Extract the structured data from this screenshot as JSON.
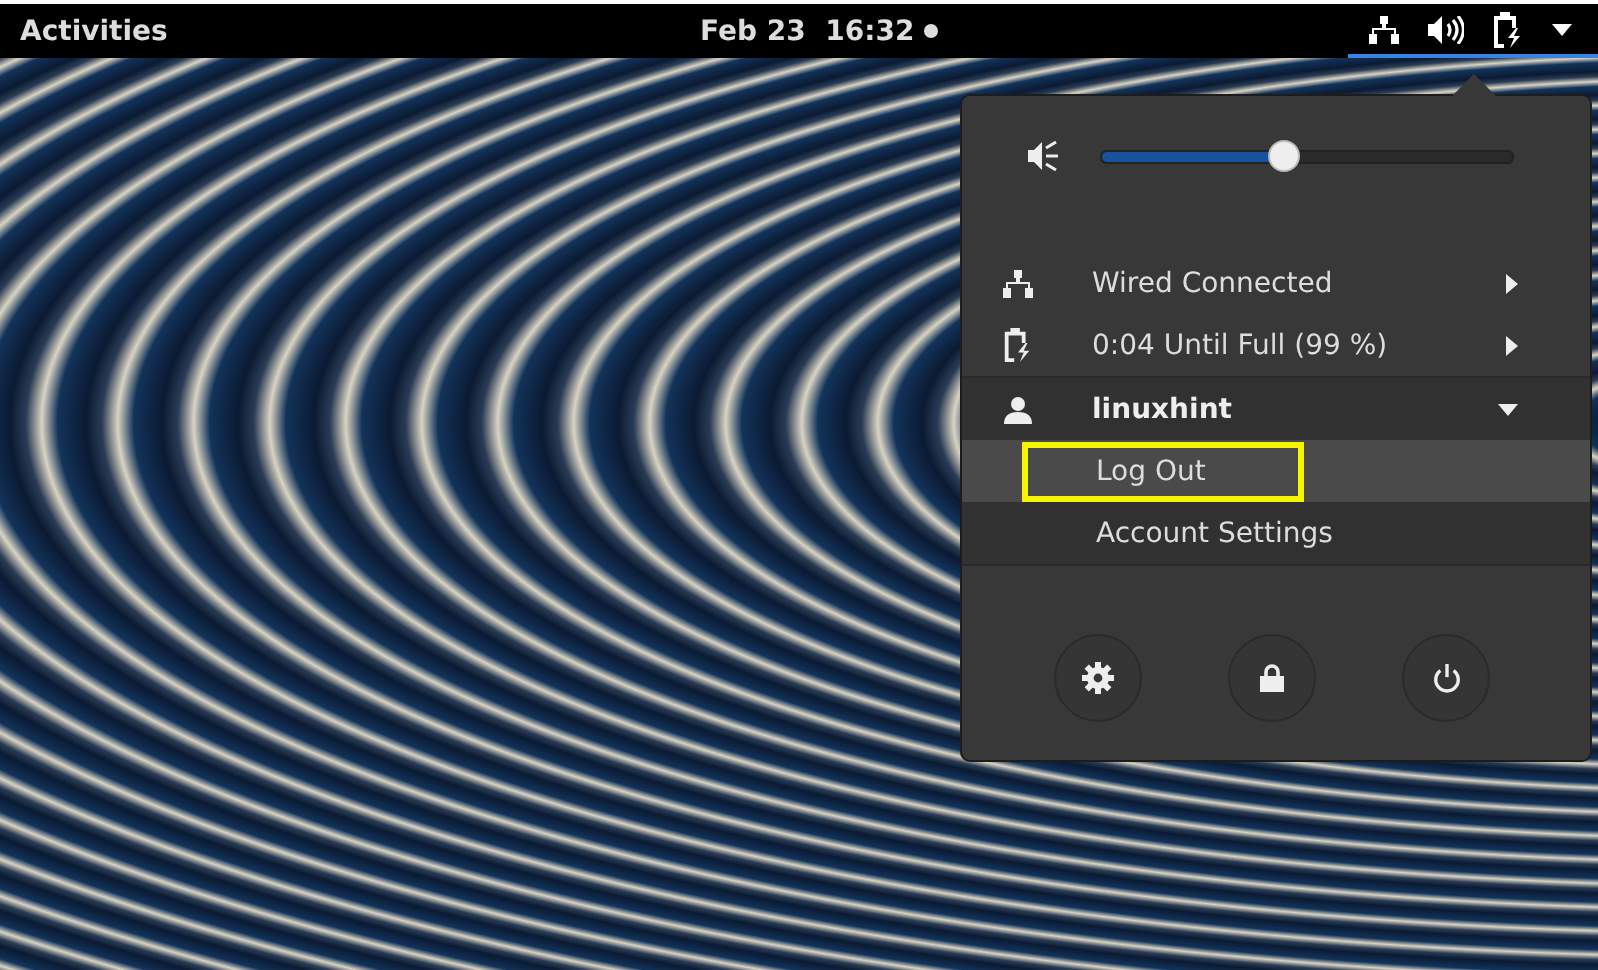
{
  "top_bar": {
    "activities": "Activities",
    "clock": "Feb 23  16:32",
    "notification_dot": true,
    "status_menu_open": true
  },
  "menu": {
    "volume": {
      "level": 0.45
    },
    "items": [
      {
        "kind": "network",
        "label": "Wired Connected"
      },
      {
        "kind": "battery",
        "label": "0:04 Until Full (99 %)"
      }
    ],
    "user": {
      "name": "linuxhint",
      "expanded": true,
      "items": [
        {
          "label": "Log Out",
          "selected": true
        },
        {
          "label": "Account Settings",
          "selected": false
        }
      ]
    },
    "actions": [
      {
        "kind": "settings"
      },
      {
        "kind": "lock"
      },
      {
        "kind": "power"
      }
    ]
  }
}
